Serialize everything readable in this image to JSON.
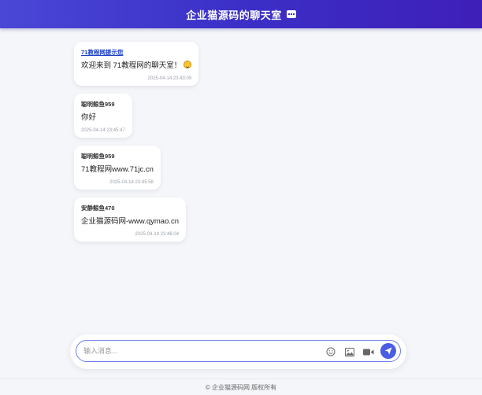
{
  "header": {
    "title": "企业猫源码的聊天室",
    "icon": "chat-bubble-icon"
  },
  "messages": [
    {
      "sender": "71教程网提示您",
      "text": "欢迎来到 71教程网的聊天室！",
      "time": "2025-04-14 23:43:09",
      "is_system": true,
      "emoji": "smile-emoji-icon"
    },
    {
      "sender": "聪明鲸鱼959",
      "text": "你好",
      "time": "2025-04-14 23:45:47"
    },
    {
      "sender": "聪明鲸鱼959",
      "text": "71教程网www.71jc.cn",
      "time": "2025-04-14 23:45:58"
    },
    {
      "sender": "安静鲸鱼470",
      "text": "企业猫源码网-www.qymao.cn",
      "time": "2025-04-14 23:46:04"
    }
  ],
  "input": {
    "placeholder": "输入消息...",
    "value": ""
  },
  "toolbar": {
    "emoji_icon": "emoji-icon",
    "image_icon": "image-icon",
    "video_icon": "video-icon",
    "send_icon": "send-icon",
    "accent": "#4a5de3"
  },
  "footer": {
    "text": "© 企业猫源码网 版权所有"
  }
}
